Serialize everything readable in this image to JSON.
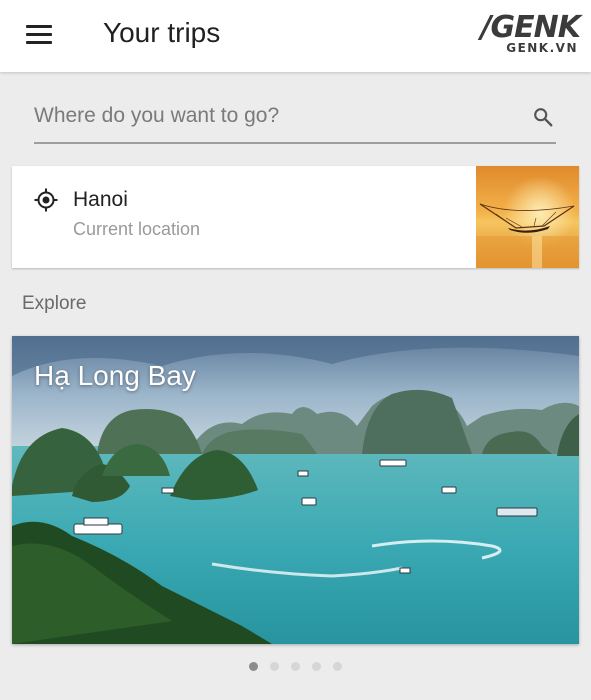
{
  "appbar": {
    "title": "Your trips",
    "logo": {
      "main": "/GENK",
      "sub": "GENK.VN"
    }
  },
  "search": {
    "placeholder": "Where do you want to go?"
  },
  "current_location": {
    "name": "Hanoi",
    "subtitle": "Current location"
  },
  "explore": {
    "label": "Explore",
    "cards": [
      {
        "title": "Hạ Long Bay"
      }
    ],
    "pager": {
      "count": 5,
      "active_index": 0
    }
  },
  "colors": {
    "appbar": "#ffffff",
    "background": "#ececec",
    "sea": "#3fb0b6",
    "sky": "#a9c3d8"
  }
}
